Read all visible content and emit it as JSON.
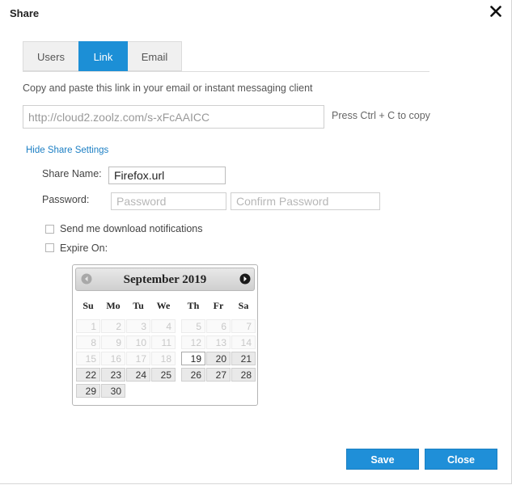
{
  "dialog": {
    "title": "Share"
  },
  "tabs": [
    {
      "label": "Users",
      "active": false
    },
    {
      "label": "Link",
      "active": true
    },
    {
      "label": "Email",
      "active": false
    }
  ],
  "link": {
    "instruction": "Copy and paste this link in your email or instant messaging client",
    "url": "http://cloud2.zoolz.com/s-xFcAAICC",
    "copy_hint": "Press Ctrl + C to copy"
  },
  "settings": {
    "toggle_label": "Hide Share Settings",
    "share_name_label": "Share Name:",
    "share_name_value": "Firefox.url",
    "password_label": "Password:",
    "password_placeholder": "Password",
    "confirm_placeholder": "Confirm Password",
    "notify_label": "Send me download notifications",
    "notify_checked": false,
    "expire_label": "Expire On:",
    "expire_checked": false
  },
  "calendar": {
    "month_label": "September 2019",
    "weekdays": [
      "Su",
      "Mo",
      "Tu",
      "We",
      "Th",
      "Fr",
      "Sa"
    ],
    "weeks": [
      [
        {
          "d": "1",
          "s": "disabled"
        },
        {
          "d": "2",
          "s": "disabled"
        },
        {
          "d": "3",
          "s": "disabled"
        },
        {
          "d": "4",
          "s": "disabled"
        },
        {
          "d": "5",
          "s": "disabled"
        },
        {
          "d": "6",
          "s": "disabled"
        },
        {
          "d": "7",
          "s": "disabled"
        }
      ],
      [
        {
          "d": "8",
          "s": "disabled"
        },
        {
          "d": "9",
          "s": "disabled"
        },
        {
          "d": "10",
          "s": "disabled"
        },
        {
          "d": "11",
          "s": "disabled"
        },
        {
          "d": "12",
          "s": "disabled"
        },
        {
          "d": "13",
          "s": "disabled"
        },
        {
          "d": "14",
          "s": "disabled"
        }
      ],
      [
        {
          "d": "15",
          "s": "disabled"
        },
        {
          "d": "16",
          "s": "disabled"
        },
        {
          "d": "17",
          "s": "disabled"
        },
        {
          "d": "18",
          "s": "disabled"
        },
        {
          "d": "19",
          "s": "today"
        },
        {
          "d": "20",
          "s": "enabled"
        },
        {
          "d": "21",
          "s": "enabled"
        }
      ],
      [
        {
          "d": "22",
          "s": "enabled"
        },
        {
          "d": "23",
          "s": "enabled"
        },
        {
          "d": "24",
          "s": "enabled"
        },
        {
          "d": "25",
          "s": "enabled"
        },
        {
          "d": "26",
          "s": "enabled"
        },
        {
          "d": "27",
          "s": "enabled"
        },
        {
          "d": "28",
          "s": "enabled"
        }
      ],
      [
        {
          "d": "29",
          "s": "enabled"
        },
        {
          "d": "30",
          "s": "enabled"
        }
      ]
    ]
  },
  "buttons": {
    "save": "Save",
    "close": "Close"
  },
  "colors": {
    "accent": "#1c8fd6",
    "link_text": "#1c7fc4"
  },
  "icons": {
    "close": "close-icon",
    "prev": "prev-month-icon",
    "next": "next-month-icon"
  }
}
